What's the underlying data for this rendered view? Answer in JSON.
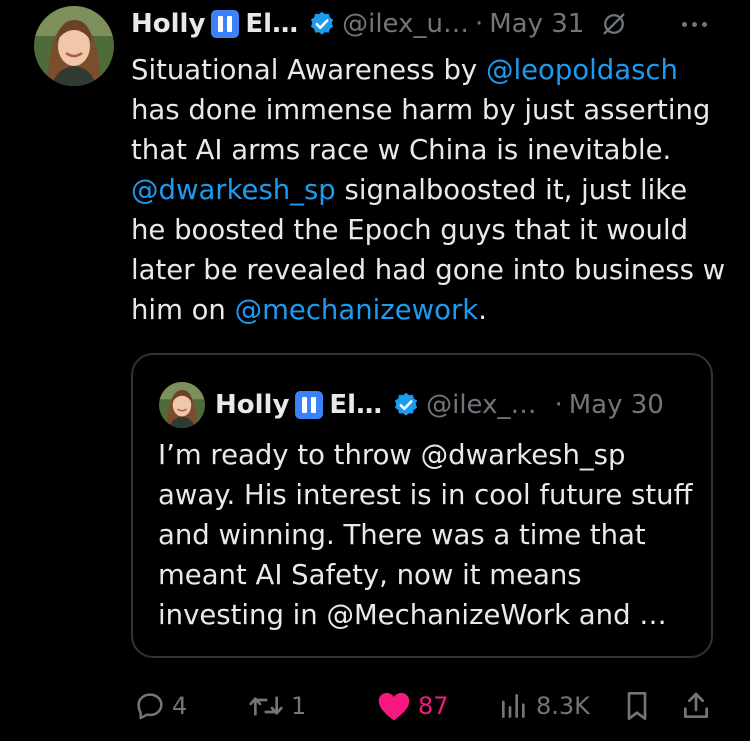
{
  "tweet": {
    "author": {
      "name": "Holly",
      "name_suffix": "El…",
      "handle": "@ilex_u…",
      "separator": "·",
      "date": "May 31"
    },
    "body_lines": [
      [
        {
          "t": "Situational Awareness by "
        },
        {
          "t": "@leopoldasch",
          "m": true
        }
      ],
      [
        {
          "t": "has done immense harm by just asserting"
        }
      ],
      [
        {
          "t": "that AI arms race w China is inevitable."
        }
      ],
      [
        {
          "t": "@dwarkesh_sp",
          "m": true
        },
        {
          "t": " signalboosted it, just like"
        }
      ],
      [
        {
          "t": "he boosted the Epoch guys that it would"
        }
      ],
      [
        {
          "t": "later be revealed had gone into business w"
        }
      ],
      [
        {
          "t": "him on "
        },
        {
          "t": "@mechanizework",
          "m": true
        },
        {
          "t": "."
        }
      ]
    ]
  },
  "quote": {
    "author": {
      "name": "Holly",
      "name_suffix": "El…",
      "handle": "@ilex_…",
      "separator": "·",
      "date": "May 30"
    },
    "body_lines": [
      "I’m ready to throw @dwarkesh_sp",
      "away. His interest is in cool future stuff",
      "and winning. There was a time that",
      "meant AI Safety, now it means",
      "investing in @MechanizeWork and …"
    ]
  },
  "actions": {
    "replies": "4",
    "reposts": "1",
    "likes": "87",
    "views": "8.3K"
  },
  "colors": {
    "background": "#000000",
    "text": "#e7e9ea",
    "muted": "#71767b",
    "accent": "#1d9bf0",
    "like": "#f91880",
    "pause_emoji": "#3b82f6",
    "border": "#2f3336"
  },
  "icons": [
    "pause-emoji-icon",
    "verified-badge-icon",
    "edit-icon",
    "more-icon",
    "reply-icon",
    "repost-icon",
    "like-icon",
    "views-icon",
    "bookmark-icon",
    "share-icon"
  ]
}
